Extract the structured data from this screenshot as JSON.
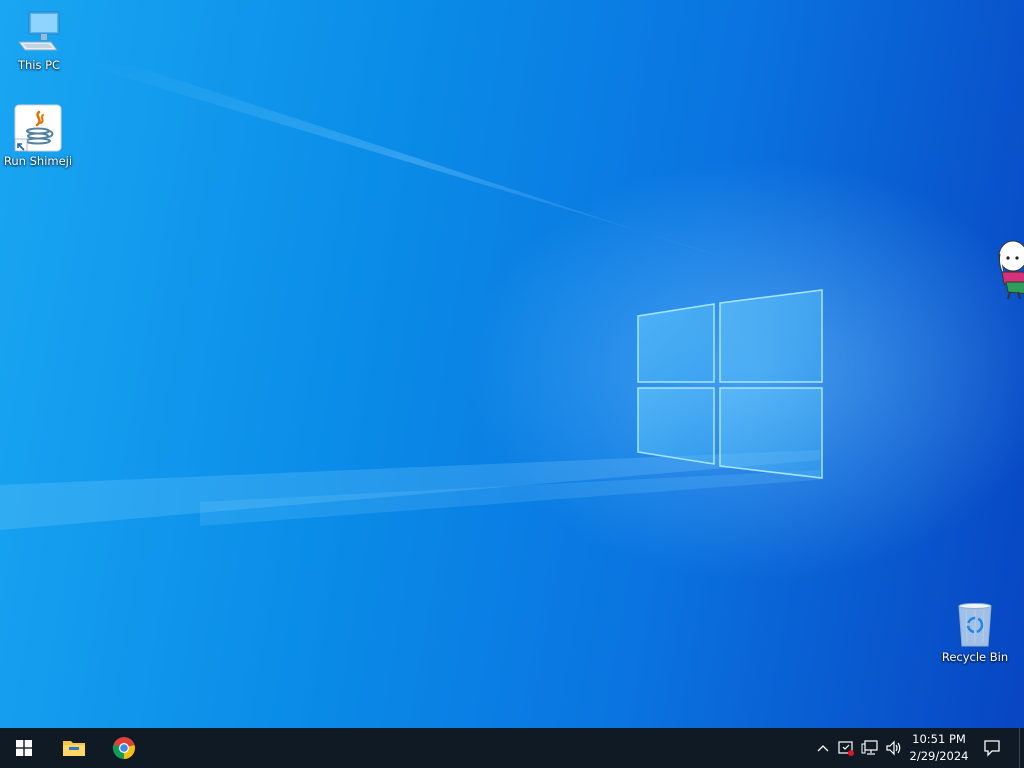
{
  "desktop": {
    "icons": [
      {
        "label": "This PC",
        "icon": "computer-icon"
      },
      {
        "label": "Run Shimeji",
        "icon": "java-icon"
      },
      {
        "label": "Recycle Bin",
        "icon": "recycle-bin-icon"
      }
    ]
  },
  "taskbar": {
    "start_icon": "windows-start-icon",
    "pinned": [
      {
        "icon": "file-explorer-icon"
      },
      {
        "icon": "chrome-icon"
      }
    ],
    "tray": {
      "icons": [
        "chevron-up-icon",
        "windows-security-icon",
        "network-icon",
        "volume-icon"
      ],
      "time": "10:51 PM",
      "date": "2/29/2024",
      "notification_icon": "notification-icon"
    }
  },
  "colors": {
    "taskbar_bg": "#0f1a24",
    "desktop_primary": "#0a8de8",
    "desktop_dark": "#0845c2"
  }
}
